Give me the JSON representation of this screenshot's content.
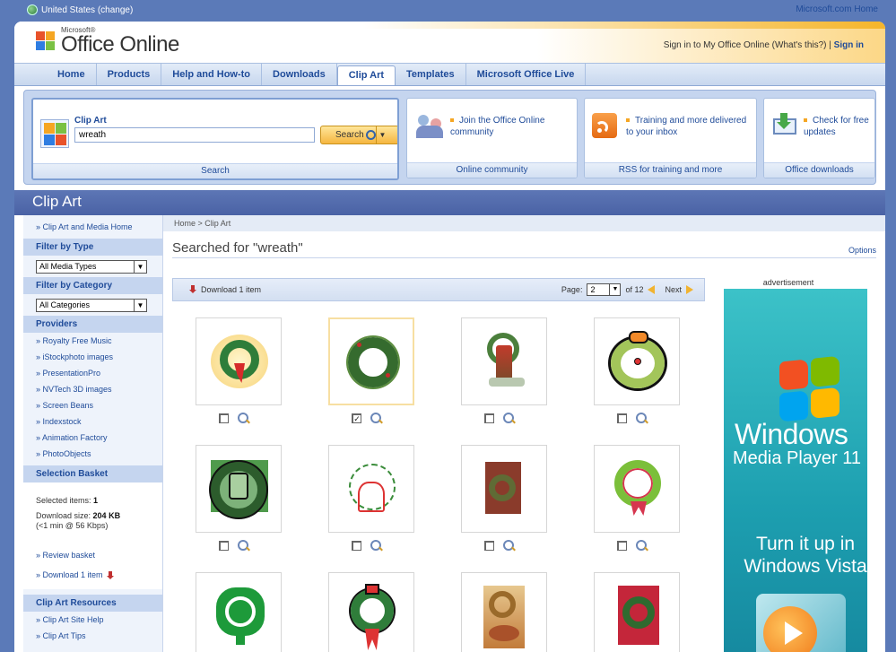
{
  "topbar": {
    "region": "United States (change)",
    "ms_home": "Microsoft.com Home"
  },
  "header": {
    "logo_small": "Microsoft®",
    "logo_main": "Office Online",
    "signin_text": "Sign in to My Office Online (What's this?) |",
    "signin_link": "Sign in"
  },
  "nav": {
    "items": [
      "Home",
      "Products",
      "Help and How-to",
      "Downloads",
      "Clip Art",
      "Templates",
      "Microsoft Office Live"
    ],
    "active": "Clip Art"
  },
  "widgets": {
    "search": {
      "label": "Clip Art",
      "value": "wreath",
      "button": "Search",
      "footer": "Search"
    },
    "community": {
      "text": "Join the Office Online community",
      "footer": "Online community"
    },
    "rss": {
      "text": "Training and more delivered to your inbox",
      "footer": "RSS for training and more"
    },
    "downloads": {
      "text": "Check for free updates",
      "footer": "Office downloads"
    }
  },
  "page": {
    "title": "Clip Art"
  },
  "sidebar": {
    "home_link": "» Clip Art and Media Home",
    "filter_type": {
      "heading": "Filter by Type",
      "selected": "All Media Types"
    },
    "filter_category": {
      "heading": "Filter by Category",
      "selected": "All Categories"
    },
    "providers": {
      "heading": "Providers",
      "items": [
        "» Royalty Free Music",
        "» iStockphoto images",
        "» PresentationPro",
        "» NVTech 3D images",
        "» Screen Beans",
        "» Indexstock",
        "» Animation Factory",
        "» PhotoObjects"
      ]
    },
    "basket": {
      "heading": "Selection Basket",
      "selected_label": "Selected items:",
      "selected_value": "1",
      "size_label": "Download size:",
      "size_value": "204 KB",
      "time": "(<1 min @ 56 Kbps)",
      "review": "» Review basket",
      "download": "» Download 1 item"
    },
    "resources": {
      "heading": "Clip Art Resources",
      "items": [
        "» Clip Art Site Help",
        "» Clip Art Tips"
      ]
    }
  },
  "main": {
    "breadcrumb": "Home  >  Clip Art",
    "search_title": "Searched for \"wreath\"",
    "options": "Options",
    "download": "Download 1 item",
    "pager": {
      "label": "Page:",
      "current": "2",
      "of": "of 12",
      "next": "Next"
    },
    "results_checked": [
      false,
      true,
      false,
      false,
      false,
      false,
      false,
      false,
      false,
      false,
      false,
      false
    ]
  },
  "ad": {
    "label": "advertisement",
    "line1": "Windows",
    "line2": "Media Player 11",
    "line3": "Turn it up in Windows Vista"
  },
  "colors": {
    "brand_blue": "#5b7ab8",
    "accent_orange": "#f5b640",
    "link": "#1f4b99"
  }
}
